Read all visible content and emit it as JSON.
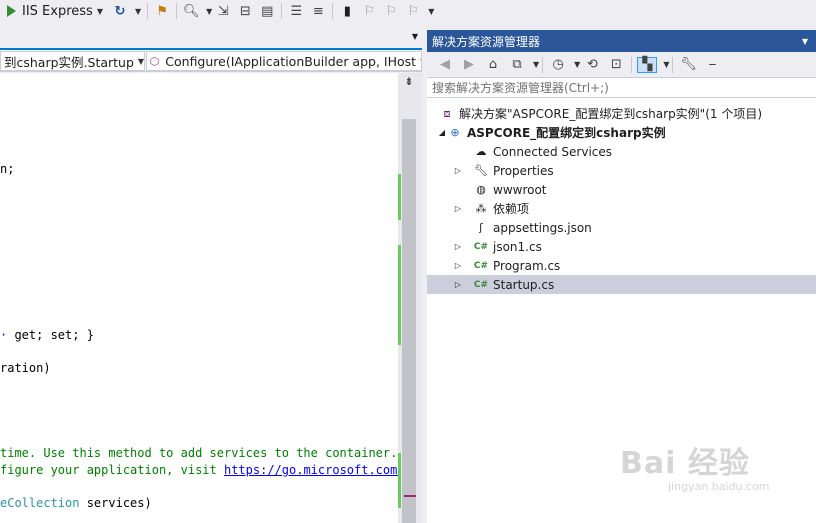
{
  "toolbar": {
    "run_target": "IIS Express"
  },
  "navbar": {
    "class_combo": "到csharp实例.Startup",
    "member_combo": "Configure(IApplicationBuilder app, IHost"
  },
  "editor": {
    "lines": [
      {
        "t": "n;"
      },
      {
        "t": " get; set; }"
      },
      {
        "t": "ration)"
      },
      {
        "t": "time. Use this method to add services to the container."
      },
      {
        "t_pre": "figure your application, visit ",
        "t_link": "https://go.microsoft.com/fw"
      },
      {
        "t_type": "eCollection",
        "t_post": " services)"
      }
    ]
  },
  "solution_explorer": {
    "title": "解决方案资源管理器",
    "search_placeholder": "搜索解决方案资源管理器(Ctrl+;)",
    "tree": [
      {
        "label": "解决方案\"ASPCORE_配置绑定到csharp实例\"(1 个项目)",
        "icon": "solution-icon"
      },
      {
        "label": "ASPCORE_配置绑定到csharp实例",
        "icon": "web-project-icon"
      },
      {
        "label": "Connected Services",
        "icon": "cloud-icon"
      },
      {
        "label": "Properties",
        "icon": "wrench-icon"
      },
      {
        "label": "wwwroot",
        "icon": "globe-icon"
      },
      {
        "label": "依赖项",
        "icon": "dependencies-icon"
      },
      {
        "label": "appsettings.json",
        "icon": "json-file-icon"
      },
      {
        "label": "json1.cs",
        "icon": "csharp-file-icon"
      },
      {
        "label": "Program.cs",
        "icon": "csharp-file-icon"
      },
      {
        "label": "Startup.cs",
        "icon": "csharp-file-icon"
      }
    ]
  },
  "watermark": {
    "main": "Bai 经验",
    "sub": "jingyan.baidu.com"
  }
}
